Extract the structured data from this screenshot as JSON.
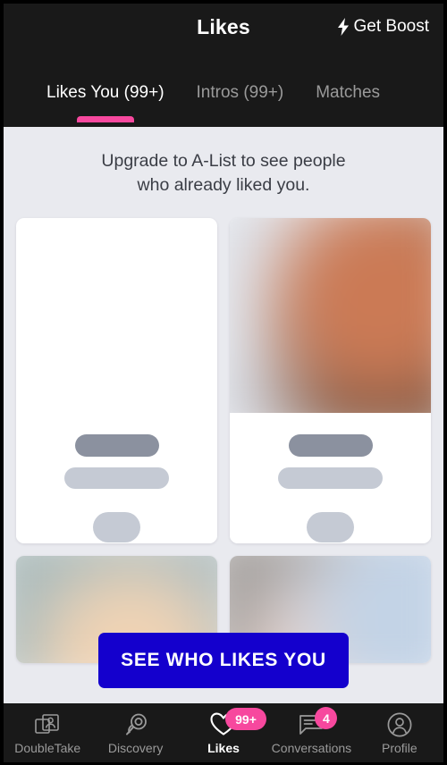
{
  "header": {
    "title": "Likes",
    "boost_label": "Get Boost",
    "boost_icon": "lightning-bolt-icon"
  },
  "tabs": [
    {
      "label": "Likes You (99+)",
      "active": true
    },
    {
      "label": "Intros (99+)",
      "active": false
    },
    {
      "label": "Matches",
      "active": false
    }
  ],
  "main": {
    "upsell_line1": "Upgrade to A-List to see people",
    "upsell_line2": "who already liked you.",
    "cta_label": "SEE WHO LIKES YOU"
  },
  "cards": [
    {
      "name": "blurred-profile-card-1"
    },
    {
      "name": "blurred-profile-card-2"
    },
    {
      "name": "blurred-profile-card-3"
    },
    {
      "name": "blurred-profile-card-4"
    }
  ],
  "nav": [
    {
      "label": "DoubleTake",
      "icon": "double-photo-person-icon",
      "badge": null,
      "active": false
    },
    {
      "label": "Discovery",
      "icon": "magnifying-glass-icon",
      "badge": null,
      "active": false
    },
    {
      "label": "Likes",
      "icon": "heart-icon",
      "badge": "99+",
      "active": true
    },
    {
      "label": "Conversations",
      "icon": "speech-bubble-icon",
      "badge": "4",
      "active": false
    },
    {
      "label": "Profile",
      "icon": "person-circle-icon",
      "badge": null,
      "active": false
    }
  ],
  "colors": {
    "accent_pink": "#f7489e",
    "cta_blue": "#1400cd",
    "header_dark": "#191919",
    "page_bg": "#e9eaef"
  }
}
